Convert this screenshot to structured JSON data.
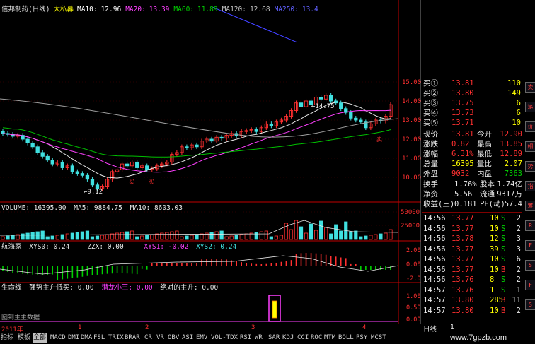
{
  "window": {
    "stock_name": "信邦制药(日线)",
    "accent_up": "#ff3030",
    "accent_down": "#00ffff"
  },
  "legend_main": {
    "period": "大私募",
    "ma": [
      {
        "label": "MA10:",
        "value": "12.96",
        "color": "#ffffff"
      },
      {
        "label": "MA20:",
        "value": "13.39",
        "color": "#ff40ff"
      },
      {
        "label": "MA60:",
        "value": "11.89",
        "color": "#00d000"
      },
      {
        "label": "MA120:",
        "value": "12.68",
        "color": "#c0c0c0"
      },
      {
        "label": "MA250:",
        "value": "13.4",
        "color": "#6060ff"
      }
    ],
    "annotations": {
      "high": "14.75",
      "low": "9.12",
      "buy": "买",
      "sell": "卖"
    }
  },
  "legend_volume": {
    "text": "VOLUME: 16395.00",
    "ma5": "MA5: 9884.75",
    "ma10": "MA10: 8603.03"
  },
  "legend_ind1": {
    "name": "航海家",
    "xys0": "XYS0: 0.24",
    "zzx": "ZZX: 0.00",
    "xys1": "XYS1: -0.02",
    "xys2": "XYS2: 0.24"
  },
  "legend_ind2": {
    "name": "生命线",
    "a": "强势主升低买: 0.00",
    "b": "潜龙小王: 0.00",
    "c": "绝对的主升: 0.00",
    "watermark": "圆到主主数据"
  },
  "price_axis": [
    "15.00",
    "14.00",
    "13.00",
    "12.00",
    "11.00",
    "10.00"
  ],
  "volume_axis": [
    "50000",
    "25000"
  ],
  "ind1_axis": [
    "2.00",
    "0.00",
    "-2.00"
  ],
  "ind2_axis": [
    "1.00",
    "0.50",
    "0.00"
  ],
  "timeline": {
    "year": "2011年",
    "marks": [
      "1",
      "2",
      "3",
      "4"
    ],
    "period": "日线"
  },
  "quote": {
    "bids": [
      {
        "label": "买①",
        "price": "13.81",
        "vol": "110"
      },
      {
        "label": "买②",
        "price": "13.80",
        "vol": "149"
      },
      {
        "label": "买③",
        "price": "13.75",
        "vol": "6"
      },
      {
        "label": "买④",
        "price": "13.73",
        "vol": "6"
      },
      {
        "label": "买⑤",
        "price": "13.71",
        "vol": "10"
      }
    ],
    "stats": [
      {
        "l1": "现价",
        "v1": "13.81",
        "c1": "red",
        "l2": "今开",
        "v2": "12.90",
        "c2": "red"
      },
      {
        "l1": "涨跌",
        "v1": "0.82",
        "c1": "red",
        "l2": "最高",
        "v2": "13.85",
        "c2": "red"
      },
      {
        "l1": "涨幅",
        "v1": "6.31%",
        "c1": "red",
        "l2": "最低",
        "v2": "12.89",
        "c2": "red"
      },
      {
        "l1": "总量",
        "v1": "16395",
        "c1": "yel",
        "l2": "量比",
        "v2": "2.07",
        "c2": "yel"
      },
      {
        "l1": "外盘",
        "v1": "9032",
        "c1": "red",
        "l2": "内盘",
        "v2": "7363",
        "c2": "grn"
      }
    ],
    "stats2": [
      {
        "l1": "换手",
        "v1": "1.76%",
        "l2": "股本",
        "v2": "1.74亿"
      },
      {
        "l1": "净资",
        "v1": "5.56",
        "l2": "流通",
        "v2": "9317万"
      },
      {
        "l1": "收益(三)",
        "v1": "0.181",
        "l2": "PE(动)",
        "v2": "57.4"
      }
    ],
    "ticks": [
      {
        "time": "14:56",
        "price": "13.77",
        "vol": "10",
        "side": "S",
        "n": "2"
      },
      {
        "time": "14:56",
        "price": "13.77",
        "vol": "10",
        "side": "S",
        "n": "2"
      },
      {
        "time": "14:56",
        "price": "13.78",
        "vol": "12",
        "side": "S",
        "n": "3"
      },
      {
        "time": "14:56",
        "price": "13.77",
        "vol": "39",
        "side": "S",
        "n": "3"
      },
      {
        "time": "14:56",
        "price": "13.77",
        "vol": "10",
        "side": "S",
        "n": "6"
      },
      {
        "time": "14:56",
        "price": "13.77",
        "vol": "10",
        "side": "B",
        "n": "2"
      },
      {
        "time": "14:56",
        "price": "13.76",
        "vol": "8",
        "side": "S",
        "n": "2"
      },
      {
        "time": "14:57",
        "price": "13.76",
        "vol": "1",
        "side": "S",
        "n": "1"
      },
      {
        "time": "14:57",
        "price": "13.80",
        "vol": "285",
        "side": "B",
        "n": "11"
      },
      {
        "time": "14:57",
        "price": "13.80",
        "vol": "10",
        "side": "B",
        "n": "2"
      }
    ]
  },
  "side_buttons": [
    "卖",
    "笔",
    "价",
    "细",
    "势",
    "指",
    "筹",
    "R",
    "F",
    "S",
    "F",
    "S"
  ],
  "tabs": [
    "指标",
    "模板",
    "全部",
    "MACD",
    "DMI",
    "DMA",
    "FSL",
    "TRIX",
    "BRAR",
    "CR",
    "VR",
    "OBV",
    "ASI",
    "EMV",
    "VOL-TDX",
    "RSI",
    "WR",
    "SAR",
    "KDJ",
    "CCI",
    "ROC",
    "MTM",
    "BOLL",
    "PSY",
    "MCST"
  ],
  "watermark_site": "www.7gpzb.com"
}
